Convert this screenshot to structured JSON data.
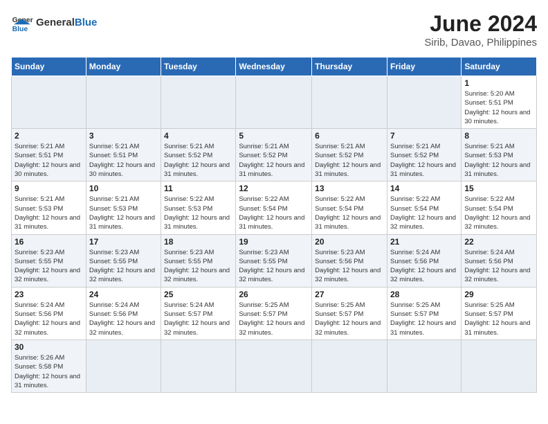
{
  "header": {
    "logo_general": "General",
    "logo_blue": "Blue",
    "month_year": "June 2024",
    "location": "Sirib, Davao, Philippines"
  },
  "weekdays": [
    "Sunday",
    "Monday",
    "Tuesday",
    "Wednesday",
    "Thursday",
    "Friday",
    "Saturday"
  ],
  "weeks": [
    [
      {
        "day": "",
        "info": ""
      },
      {
        "day": "",
        "info": ""
      },
      {
        "day": "",
        "info": ""
      },
      {
        "day": "",
        "info": ""
      },
      {
        "day": "",
        "info": ""
      },
      {
        "day": "",
        "info": ""
      },
      {
        "day": "1",
        "info": "Sunrise: 5:20 AM\nSunset: 5:51 PM\nDaylight: 12 hours and 30 minutes."
      }
    ],
    [
      {
        "day": "2",
        "info": "Sunrise: 5:21 AM\nSunset: 5:51 PM\nDaylight: 12 hours and 30 minutes."
      },
      {
        "day": "3",
        "info": "Sunrise: 5:21 AM\nSunset: 5:51 PM\nDaylight: 12 hours and 30 minutes."
      },
      {
        "day": "4",
        "info": "Sunrise: 5:21 AM\nSunset: 5:52 PM\nDaylight: 12 hours and 31 minutes."
      },
      {
        "day": "5",
        "info": "Sunrise: 5:21 AM\nSunset: 5:52 PM\nDaylight: 12 hours and 31 minutes."
      },
      {
        "day": "6",
        "info": "Sunrise: 5:21 AM\nSunset: 5:52 PM\nDaylight: 12 hours and 31 minutes."
      },
      {
        "day": "7",
        "info": "Sunrise: 5:21 AM\nSunset: 5:52 PM\nDaylight: 12 hours and 31 minutes."
      },
      {
        "day": "8",
        "info": "Sunrise: 5:21 AM\nSunset: 5:53 PM\nDaylight: 12 hours and 31 minutes."
      }
    ],
    [
      {
        "day": "9",
        "info": "Sunrise: 5:21 AM\nSunset: 5:53 PM\nDaylight: 12 hours and 31 minutes."
      },
      {
        "day": "10",
        "info": "Sunrise: 5:21 AM\nSunset: 5:53 PM\nDaylight: 12 hours and 31 minutes."
      },
      {
        "day": "11",
        "info": "Sunrise: 5:22 AM\nSunset: 5:53 PM\nDaylight: 12 hours and 31 minutes."
      },
      {
        "day": "12",
        "info": "Sunrise: 5:22 AM\nSunset: 5:54 PM\nDaylight: 12 hours and 31 minutes."
      },
      {
        "day": "13",
        "info": "Sunrise: 5:22 AM\nSunset: 5:54 PM\nDaylight: 12 hours and 31 minutes."
      },
      {
        "day": "14",
        "info": "Sunrise: 5:22 AM\nSunset: 5:54 PM\nDaylight: 12 hours and 32 minutes."
      },
      {
        "day": "15",
        "info": "Sunrise: 5:22 AM\nSunset: 5:54 PM\nDaylight: 12 hours and 32 minutes."
      }
    ],
    [
      {
        "day": "16",
        "info": "Sunrise: 5:23 AM\nSunset: 5:55 PM\nDaylight: 12 hours and 32 minutes."
      },
      {
        "day": "17",
        "info": "Sunrise: 5:23 AM\nSunset: 5:55 PM\nDaylight: 12 hours and 32 minutes."
      },
      {
        "day": "18",
        "info": "Sunrise: 5:23 AM\nSunset: 5:55 PM\nDaylight: 12 hours and 32 minutes."
      },
      {
        "day": "19",
        "info": "Sunrise: 5:23 AM\nSunset: 5:55 PM\nDaylight: 12 hours and 32 minutes."
      },
      {
        "day": "20",
        "info": "Sunrise: 5:23 AM\nSunset: 5:56 PM\nDaylight: 12 hours and 32 minutes."
      },
      {
        "day": "21",
        "info": "Sunrise: 5:24 AM\nSunset: 5:56 PM\nDaylight: 12 hours and 32 minutes."
      },
      {
        "day": "22",
        "info": "Sunrise: 5:24 AM\nSunset: 5:56 PM\nDaylight: 12 hours and 32 minutes."
      }
    ],
    [
      {
        "day": "23",
        "info": "Sunrise: 5:24 AM\nSunset: 5:56 PM\nDaylight: 12 hours and 32 minutes."
      },
      {
        "day": "24",
        "info": "Sunrise: 5:24 AM\nSunset: 5:56 PM\nDaylight: 12 hours and 32 minutes."
      },
      {
        "day": "25",
        "info": "Sunrise: 5:24 AM\nSunset: 5:57 PM\nDaylight: 12 hours and 32 minutes."
      },
      {
        "day": "26",
        "info": "Sunrise: 5:25 AM\nSunset: 5:57 PM\nDaylight: 12 hours and 32 minutes."
      },
      {
        "day": "27",
        "info": "Sunrise: 5:25 AM\nSunset: 5:57 PM\nDaylight: 12 hours and 32 minutes."
      },
      {
        "day": "28",
        "info": "Sunrise: 5:25 AM\nSunset: 5:57 PM\nDaylight: 12 hours and 31 minutes."
      },
      {
        "day": "29",
        "info": "Sunrise: 5:25 AM\nSunset: 5:57 PM\nDaylight: 12 hours and 31 minutes."
      }
    ],
    [
      {
        "day": "30",
        "info": "Sunrise: 5:26 AM\nSunset: 5:58 PM\nDaylight: 12 hours and 31 minutes."
      },
      {
        "day": "",
        "info": ""
      },
      {
        "day": "",
        "info": ""
      },
      {
        "day": "",
        "info": ""
      },
      {
        "day": "",
        "info": ""
      },
      {
        "day": "",
        "info": ""
      },
      {
        "day": "",
        "info": ""
      }
    ]
  ]
}
